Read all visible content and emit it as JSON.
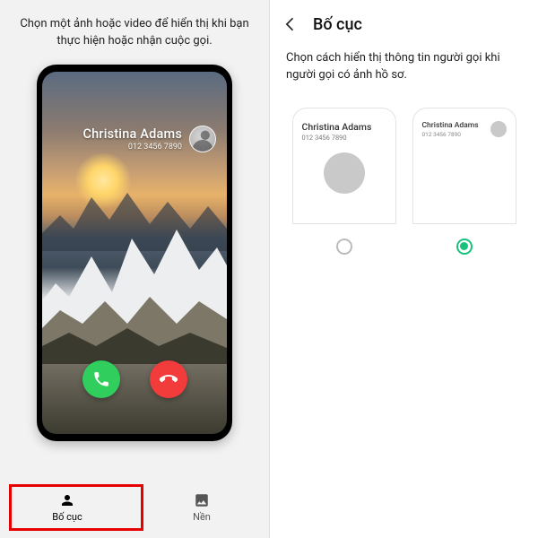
{
  "left": {
    "description": "Chọn một ảnh hoặc video để hiển thị khi bạn thực hiện hoặc nhận cuộc gọi.",
    "caller": {
      "name": "Christina Adams",
      "number": "012 3456 7890"
    },
    "tabs": {
      "layout": "Bố cục",
      "background": "Nền"
    }
  },
  "right": {
    "title": "Bố cục",
    "description": "Chọn cách hiển thị thông tin người gọi khi người gọi có ảnh hồ sơ.",
    "sample": {
      "name": "Christina Adams",
      "number": "012 3456 7890"
    },
    "selected": 1,
    "accent": "#19c27c"
  }
}
